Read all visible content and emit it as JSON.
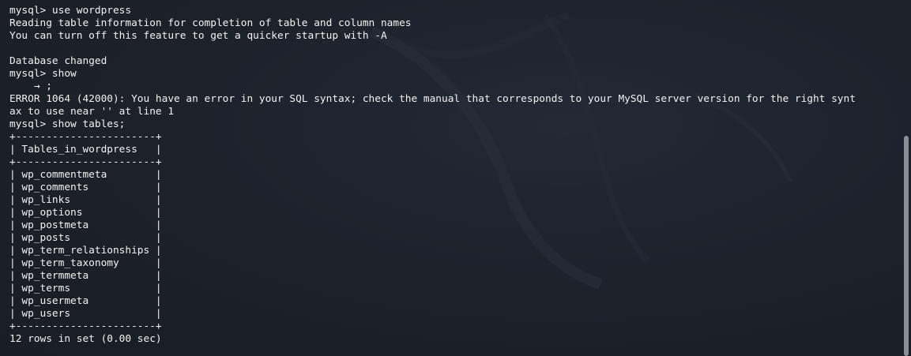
{
  "terminal": {
    "lines": [
      "mysql> use wordpress",
      "Reading table information for completion of table and column names",
      "You can turn off this feature to get a quicker startup with -A",
      "",
      "Database changed",
      "mysql> show",
      "    → ;",
      "ERROR 1064 (42000): You have an error in your SQL syntax; check the manual that corresponds to your MySQL server version for the right synt",
      "ax to use near '' at line 1",
      "mysql> show tables;",
      "+-----------------------+",
      "| Tables_in_wordpress   |",
      "+-----------------------+",
      "| wp_commentmeta        |",
      "| wp_comments           |",
      "| wp_links              |",
      "| wp_options            |",
      "| wp_postmeta           |",
      "| wp_posts              |",
      "| wp_term_relationships |",
      "| wp_term_taxonomy      |",
      "| wp_termmeta           |",
      "| wp_terms              |",
      "| wp_usermeta           |",
      "| wp_users              |",
      "+-----------------------+",
      "12 rows in set (0.00 sec)"
    ]
  },
  "colors": {
    "background": "#1b2029",
    "text": "#f2f2f2",
    "scrollbar_thumb": "#8a8f96"
  }
}
